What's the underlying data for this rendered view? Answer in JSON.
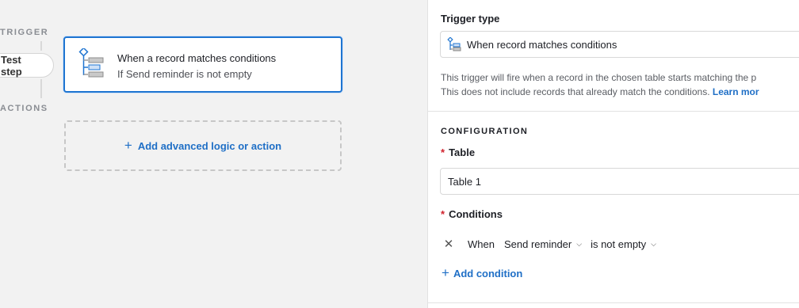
{
  "canvas": {
    "trigger_label": "TRIGGER",
    "actions_label": "ACTIONS",
    "test_step_label": "Test step",
    "trigger_card": {
      "title": "When a record matches conditions",
      "subtitle": "If Send reminder is not empty",
      "icon": "record-conditions-icon"
    },
    "add_action_label": "Add advanced logic or action"
  },
  "panel": {
    "trigger_type_label": "Trigger type",
    "trigger_type_value": "When record matches conditions",
    "description_line1": "This trigger will fire when a record in the chosen table starts matching the p",
    "description_line2": "This does not include records that already match the conditions.",
    "learn_more": "Learn mor",
    "configuration_title": "CONFIGURATION",
    "required_mark": "*",
    "table_label": "Table",
    "table_value": "Table 1",
    "conditions_label": "Conditions",
    "condition": {
      "remove_icon": "close-icon",
      "when_label": "When",
      "field": "Send reminder",
      "operator": "is not empty"
    },
    "add_condition_label": "Add condition"
  },
  "colors": {
    "accent": "#1f75d1",
    "link": "#1f6fc6",
    "required": "#d0212c",
    "canvas_bg": "#f2f2f2"
  }
}
